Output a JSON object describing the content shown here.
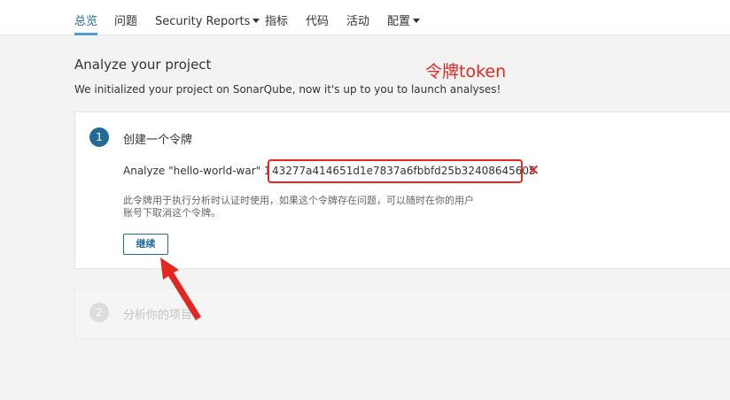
{
  "nav": {
    "tabs": [
      {
        "label": "总览",
        "active": true
      },
      {
        "label": "问题"
      },
      {
        "label": "Security Reports",
        "dropdown": true
      },
      {
        "label": "指标"
      },
      {
        "label": "代码"
      },
      {
        "label": "活动"
      },
      {
        "label": "配置",
        "dropdown": true
      }
    ]
  },
  "header": {
    "title": "Analyze your project",
    "description": "We initialized your project on SonarQube, now it's up to you to launch analyses!"
  },
  "annotation": {
    "label": "令牌token",
    "color": "#e3261f"
  },
  "step1": {
    "number": "1",
    "title": "创建一个令牌",
    "token_prefix": "Analyze \"hello-world-war\" 1:",
    "token_value": "43277a414651d1e7837a6fbbfd25b32408645605",
    "delete_icon": "×",
    "help_line1": "此令牌用于执行分析时认证时使用，如果这个令牌存在问题，可以随时在你的用户",
    "help_line2": "账号下取消这个令牌。",
    "continue_label": "继续"
  },
  "step2": {
    "number": "2",
    "title": "分析你的项目"
  },
  "colors": {
    "accent": "#236a97",
    "tab_underline": "#4b9fd5",
    "delete": "#d02f3a"
  }
}
